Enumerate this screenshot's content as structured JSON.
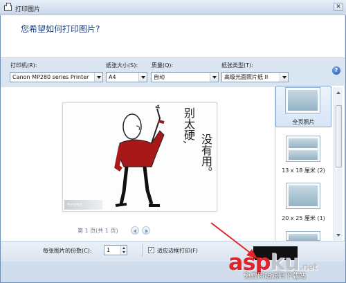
{
  "window": {
    "title": "打印图片"
  },
  "header": {
    "question": "您希望如何打印图片?"
  },
  "fields": {
    "printer": {
      "label": "打印机(R):",
      "value": "Canon MP280 series Printer"
    },
    "paper_size": {
      "label": "纸张大小(S):",
      "value": "A4"
    },
    "quality": {
      "label": "质量(Q):",
      "value": "自动"
    },
    "paper_type": {
      "label": "纸张类型(T):",
      "value": "高级光面照片纸 II"
    }
  },
  "preview": {
    "text_col1": "别太硬,",
    "text_col2": "没有用。",
    "watermark": "Pinterest"
  },
  "pager": {
    "text": "第 1 页(共 1 页)"
  },
  "layouts": [
    {
      "label": "全页照片"
    },
    {
      "label": "13 x 18 厘米 (2)"
    },
    {
      "label": "20 x 25 厘米 (1)"
    }
  ],
  "bottom": {
    "copies_label": "每张图片的份数(C):",
    "copies_value": "1",
    "fit_checked": "✓",
    "fit_label": "适应边框打印(F)"
  },
  "overlay": {
    "brand_main": "asp",
    "brand_ku": "ku",
    "brand_tld": ".net",
    "subtitle": "免费网站源码下载站"
  },
  "colors": {
    "title_blue": "#1e3e78",
    "overlay_red": "#e0242a"
  }
}
